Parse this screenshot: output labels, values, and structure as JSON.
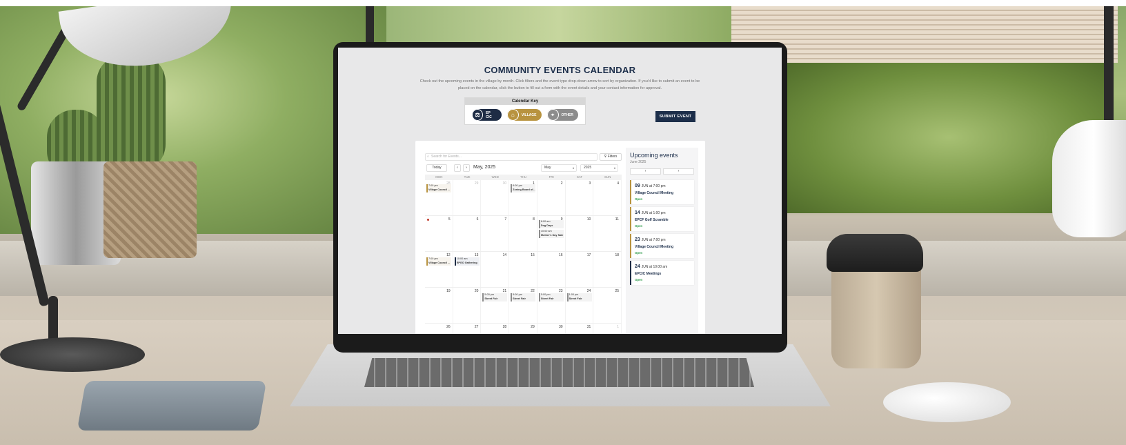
{
  "page": {
    "title": "COMMUNITY EVENTS CALENDAR",
    "intro": "Check out the upcoming events in the village by month. Click filters and the event type drop-down arrow to sort by organization. If you'd like to submit an event to be placed on the calendar, click the button to fill out a form with the event details and your contact information for approval.",
    "submit_label": "SUBMIT EVENT"
  },
  "calendar_key": {
    "title": "Calendar Key",
    "items": [
      {
        "label": "EP CIC",
        "color": "#1e2c45",
        "icon": "gavel-icon"
      },
      {
        "label": "VILLAGE",
        "color": "#b8933f",
        "icon": "building-icon"
      },
      {
        "label": "OTHER",
        "color": "#8c8c8c",
        "icon": "map-pin-icon"
      }
    ]
  },
  "calendar": {
    "search_placeholder": "Search for Events...",
    "filters_label": "Filters",
    "today_label": "Today",
    "month_label": "May, 2025",
    "month_select": "May",
    "year_select": "2025",
    "weekdays": [
      "MON",
      "TUE",
      "WED",
      "THU",
      "FRI",
      "SAT",
      "SUN"
    ],
    "weeks": [
      [
        "28",
        "29",
        "30",
        "1",
        "2",
        "3",
        "4"
      ],
      [
        "5",
        "6",
        "7",
        "8",
        "9",
        "10",
        "11"
      ],
      [
        "12",
        "13",
        "14",
        "15",
        "16",
        "17",
        "18"
      ],
      [
        "19",
        "20",
        "21",
        "22",
        "23",
        "24",
        "25"
      ],
      [
        "26",
        "27",
        "28",
        "29",
        "30",
        "31",
        "1"
      ]
    ],
    "events": {
      "w0_mon": {
        "time": "7:00 pm",
        "name": "Village Council ..."
      },
      "w0_thu": {
        "time": "6:00 pm",
        "name": "Zoning Board of..."
      },
      "w1_sat_a": {
        "time": "8:00 am",
        "name": "Dog Days"
      },
      "w1_sat_b": {
        "time": "10:00 am",
        "name": "Mother's Day Sale"
      },
      "w2_mon": {
        "time": "7:00 pm",
        "name": "Village Council ..."
      },
      "w2_tue": {
        "time": "10:00 am",
        "name": "EPGO Gathering"
      },
      "w3_wed": {
        "time": "5:00 pm",
        "name": "Street Fair"
      },
      "w3_thu": {
        "time": "5:00 pm",
        "name": "Street Fair"
      },
      "w3_fri": {
        "time": "5:00 pm",
        "name": "Street Fair"
      },
      "w3_sat": {
        "time": "1:00 pm",
        "name": "Street Fair"
      }
    }
  },
  "upcoming": {
    "title": "Upcoming events",
    "subtitle": "June 2025",
    "prev": "‹",
    "next": "›",
    "items": [
      {
        "day": "09",
        "when": "JUN at 7:00 pm",
        "name": "Village Council Meeting",
        "status": "Open"
      },
      {
        "day": "14",
        "when": "JUN at 1:00 pm",
        "name": "EPCF Golf Scramble",
        "status": "Open"
      },
      {
        "day": "23",
        "when": "JUN at 7:00 pm",
        "name": "Village Council Meeting",
        "status": "Open"
      },
      {
        "day": "24",
        "when": "JUN at 10:00 am",
        "name": "EPCIC Meetings",
        "status": "Open"
      }
    ]
  }
}
